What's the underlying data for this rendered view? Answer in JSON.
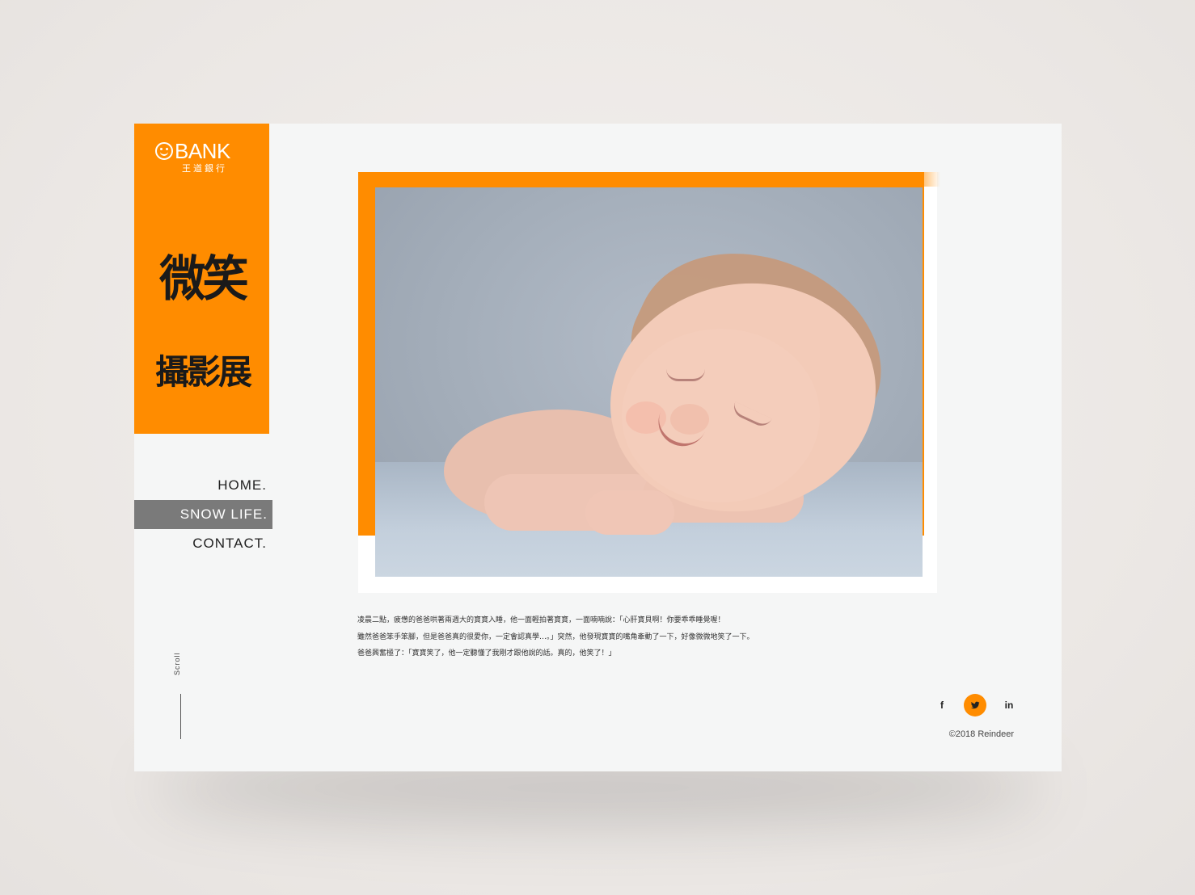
{
  "brand": {
    "logo_text": "BANK",
    "logo_sub": "王道銀行",
    "title_line1": "微笑",
    "title_line2": "攝影展",
    "accent_color": "#ff8c00"
  },
  "nav": {
    "items": [
      {
        "label": "HOME.",
        "active": false
      },
      {
        "label": "SNOW LIFE.",
        "active": true
      },
      {
        "label": "CONTACT.",
        "active": false
      }
    ]
  },
  "scroll": {
    "label": "Scroll"
  },
  "caption": {
    "lines": [
      "凌晨二點，疲憊的爸爸哄著兩週大的寶寶入睡，他一面輕拍著寶寶，一面喃喃說：「心肝寶貝啊！你要乖乖睡覺喔！",
      "雖然爸爸笨手笨腳，但是爸爸真的很愛你，一定會認真學…。」突然，他發現寶寶的嘴角牽動了一下，好像微微地笑了一下。",
      "爸爸興奮極了：「寶寶笑了，他一定聽懂了我剛才跟他說的話。真的，他笑了！」"
    ]
  },
  "social": {
    "icons": [
      {
        "name": "facebook-icon",
        "glyph": "f"
      },
      {
        "name": "twitter-icon",
        "glyph": "🐦"
      },
      {
        "name": "linkedin-icon",
        "glyph": "in"
      }
    ]
  },
  "footer": {
    "copyright": "©2018 Reindeer"
  }
}
